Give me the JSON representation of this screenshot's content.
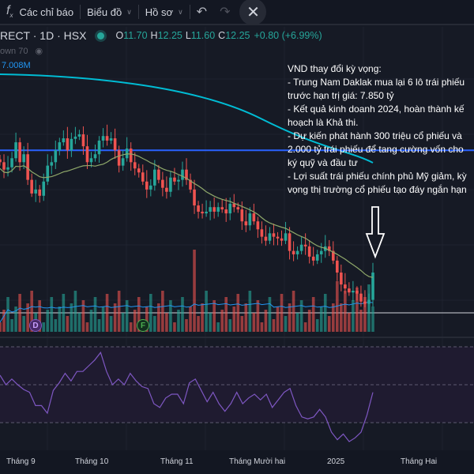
{
  "toolbar": {
    "fx_icon": "fx-icon",
    "indicators": "Các chỉ báo",
    "chart_type": "Biểu đồ",
    "profile": "Hồ sơ",
    "undo_icon": "undo-icon",
    "redo_icon": "redo-icon",
    "close_icon": "close-icon"
  },
  "legend": {
    "symbol": "RECT · 1D · HSX",
    "o_label": "O",
    "o": "11.70",
    "h_label": "H",
    "h": "12.25",
    "l_label": "L",
    "l": "11.60",
    "c_label": "C",
    "c": "12.25",
    "change": "+0.80 (+6.99%)",
    "sub": "own 70",
    "volume_ma": "7.008M"
  },
  "note": {
    "text": "VND thay đổi kỳ vọng:\n- Trung Nam Daklak mua lại 6 lô trái phiếu\ntrước hạn trị giá: 7.850 tỷ\n- Kết quả kinh doanh 2024, hoàn thành kế\nhoạch là Khả thi.\n- Dự kiến phát hành 300 triệu cổ phiếu và\n2.000 tỷ trái phiếu để tang cường vốn cho\nký quỹ và đầu tư\n- Lợi suất trái phiếu chính phủ Mỹ giảm, kỳ\nvọng thị trường cổ phiếu tạo đáy ngắn hạn"
  },
  "events": {
    "d": "D",
    "f": "F"
  },
  "xaxis": [
    "Tháng 9",
    "Tháng 10",
    "Tháng 11",
    "Tháng Mười hai",
    "2025",
    "Tháng Hai"
  ],
  "colors": {
    "up": "#26a69a",
    "down": "#ef5350",
    "ma": "#8fa86a",
    "long_ma": "#00bcd4",
    "hline": "#2962ff",
    "rsi": "#7e57c2"
  },
  "chart_data": {
    "type": "candlestick",
    "closes": [
      14.19,
      14.06,
      14.1,
      14.26,
      14.54,
      14.19,
      14.33,
      13.88,
      13.64,
      13.71,
      13.6,
      13.85,
      14.13,
      14.19,
      14.4,
      14.54,
      14.61,
      14.4,
      14.6,
      14.64,
      14.68,
      14.47,
      14.19,
      14.26,
      14.33,
      14.57,
      14.65,
      14.57,
      14.61,
      14.4,
      14.13,
      14.26,
      14.43,
      14.19,
      14.08,
      14.01,
      13.85,
      13.71,
      13.78,
      14.06,
      13.88,
      13.74,
      13.67,
      13.92,
      13.85,
      13.88,
      14.06,
      13.88,
      13.71,
      13.43,
      13.32,
      13.29,
      13.32,
      13.4,
      13.32,
      13.4,
      13.36,
      13.29,
      13.46,
      13.4,
      13.36,
      13.15,
      13.08,
      13.29,
      13.15,
      13.01,
      12.88,
      12.81,
      12.94,
      12.88,
      12.85,
      12.81,
      12.94,
      12.63,
      12.57,
      12.63,
      12.74,
      12.71,
      12.53,
      12.46,
      12.57,
      12.63,
      12.71,
      12.63,
      12.46,
      12.25,
      12.04,
      11.97,
      11.9,
      11.93,
      11.88,
      11.74,
      11.7,
      11.77,
      12.25
    ],
    "hline_price": 14.4,
    "rsi": [
      55,
      50,
      53,
      50,
      47.5,
      46,
      39,
      39,
      35,
      47,
      51,
      56,
      52,
      57,
      57,
      60,
      63,
      67,
      57,
      50,
      53,
      50,
      56,
      52,
      49,
      48,
      40,
      38,
      43,
      45,
      45,
      40,
      51,
      53,
      47,
      41,
      46,
      40,
      36,
      40,
      46,
      40,
      43,
      45,
      42,
      45,
      38,
      42,
      46,
      48,
      39,
      33,
      32,
      33,
      37,
      33,
      25,
      21,
      24,
      20,
      22,
      25,
      34,
      46
    ],
    "rsi_levels": [
      70,
      50,
      30
    ]
  }
}
